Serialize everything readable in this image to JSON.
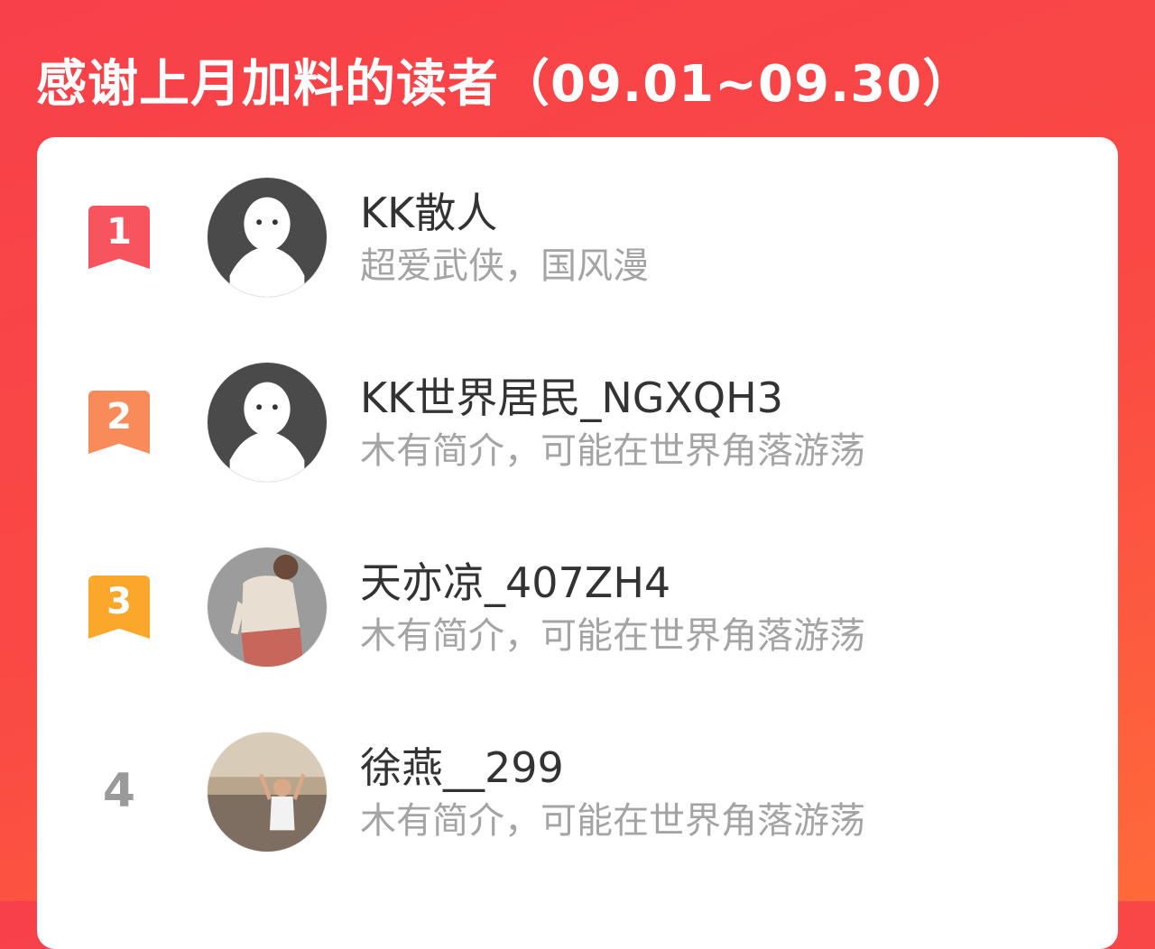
{
  "header": {
    "title": "感谢上月加料的读者（09.01~09.30）"
  },
  "readers": [
    {
      "rank": "1",
      "name": "KK散人",
      "bio": "超爱武侠，国风漫",
      "badge_color": "#f7545d"
    },
    {
      "rank": "2",
      "name": "KK世界居民_NGXQH3",
      "bio": "木有简介，可能在世界角落游荡",
      "badge_color": "#f98a5a"
    },
    {
      "rank": "3",
      "name": "天亦凉_407ZH4",
      "bio": "木有简介，可能在世界角落游荡",
      "badge_color": "#fba72c"
    },
    {
      "rank": "4",
      "name": "徐燕__299",
      "bio": "木有简介，可能在世界角落游荡"
    }
  ],
  "colors": {
    "background": "#f8404a",
    "rank_plain": "#9a9a9a",
    "name": "#333333",
    "bio": "#a4a4a4"
  }
}
